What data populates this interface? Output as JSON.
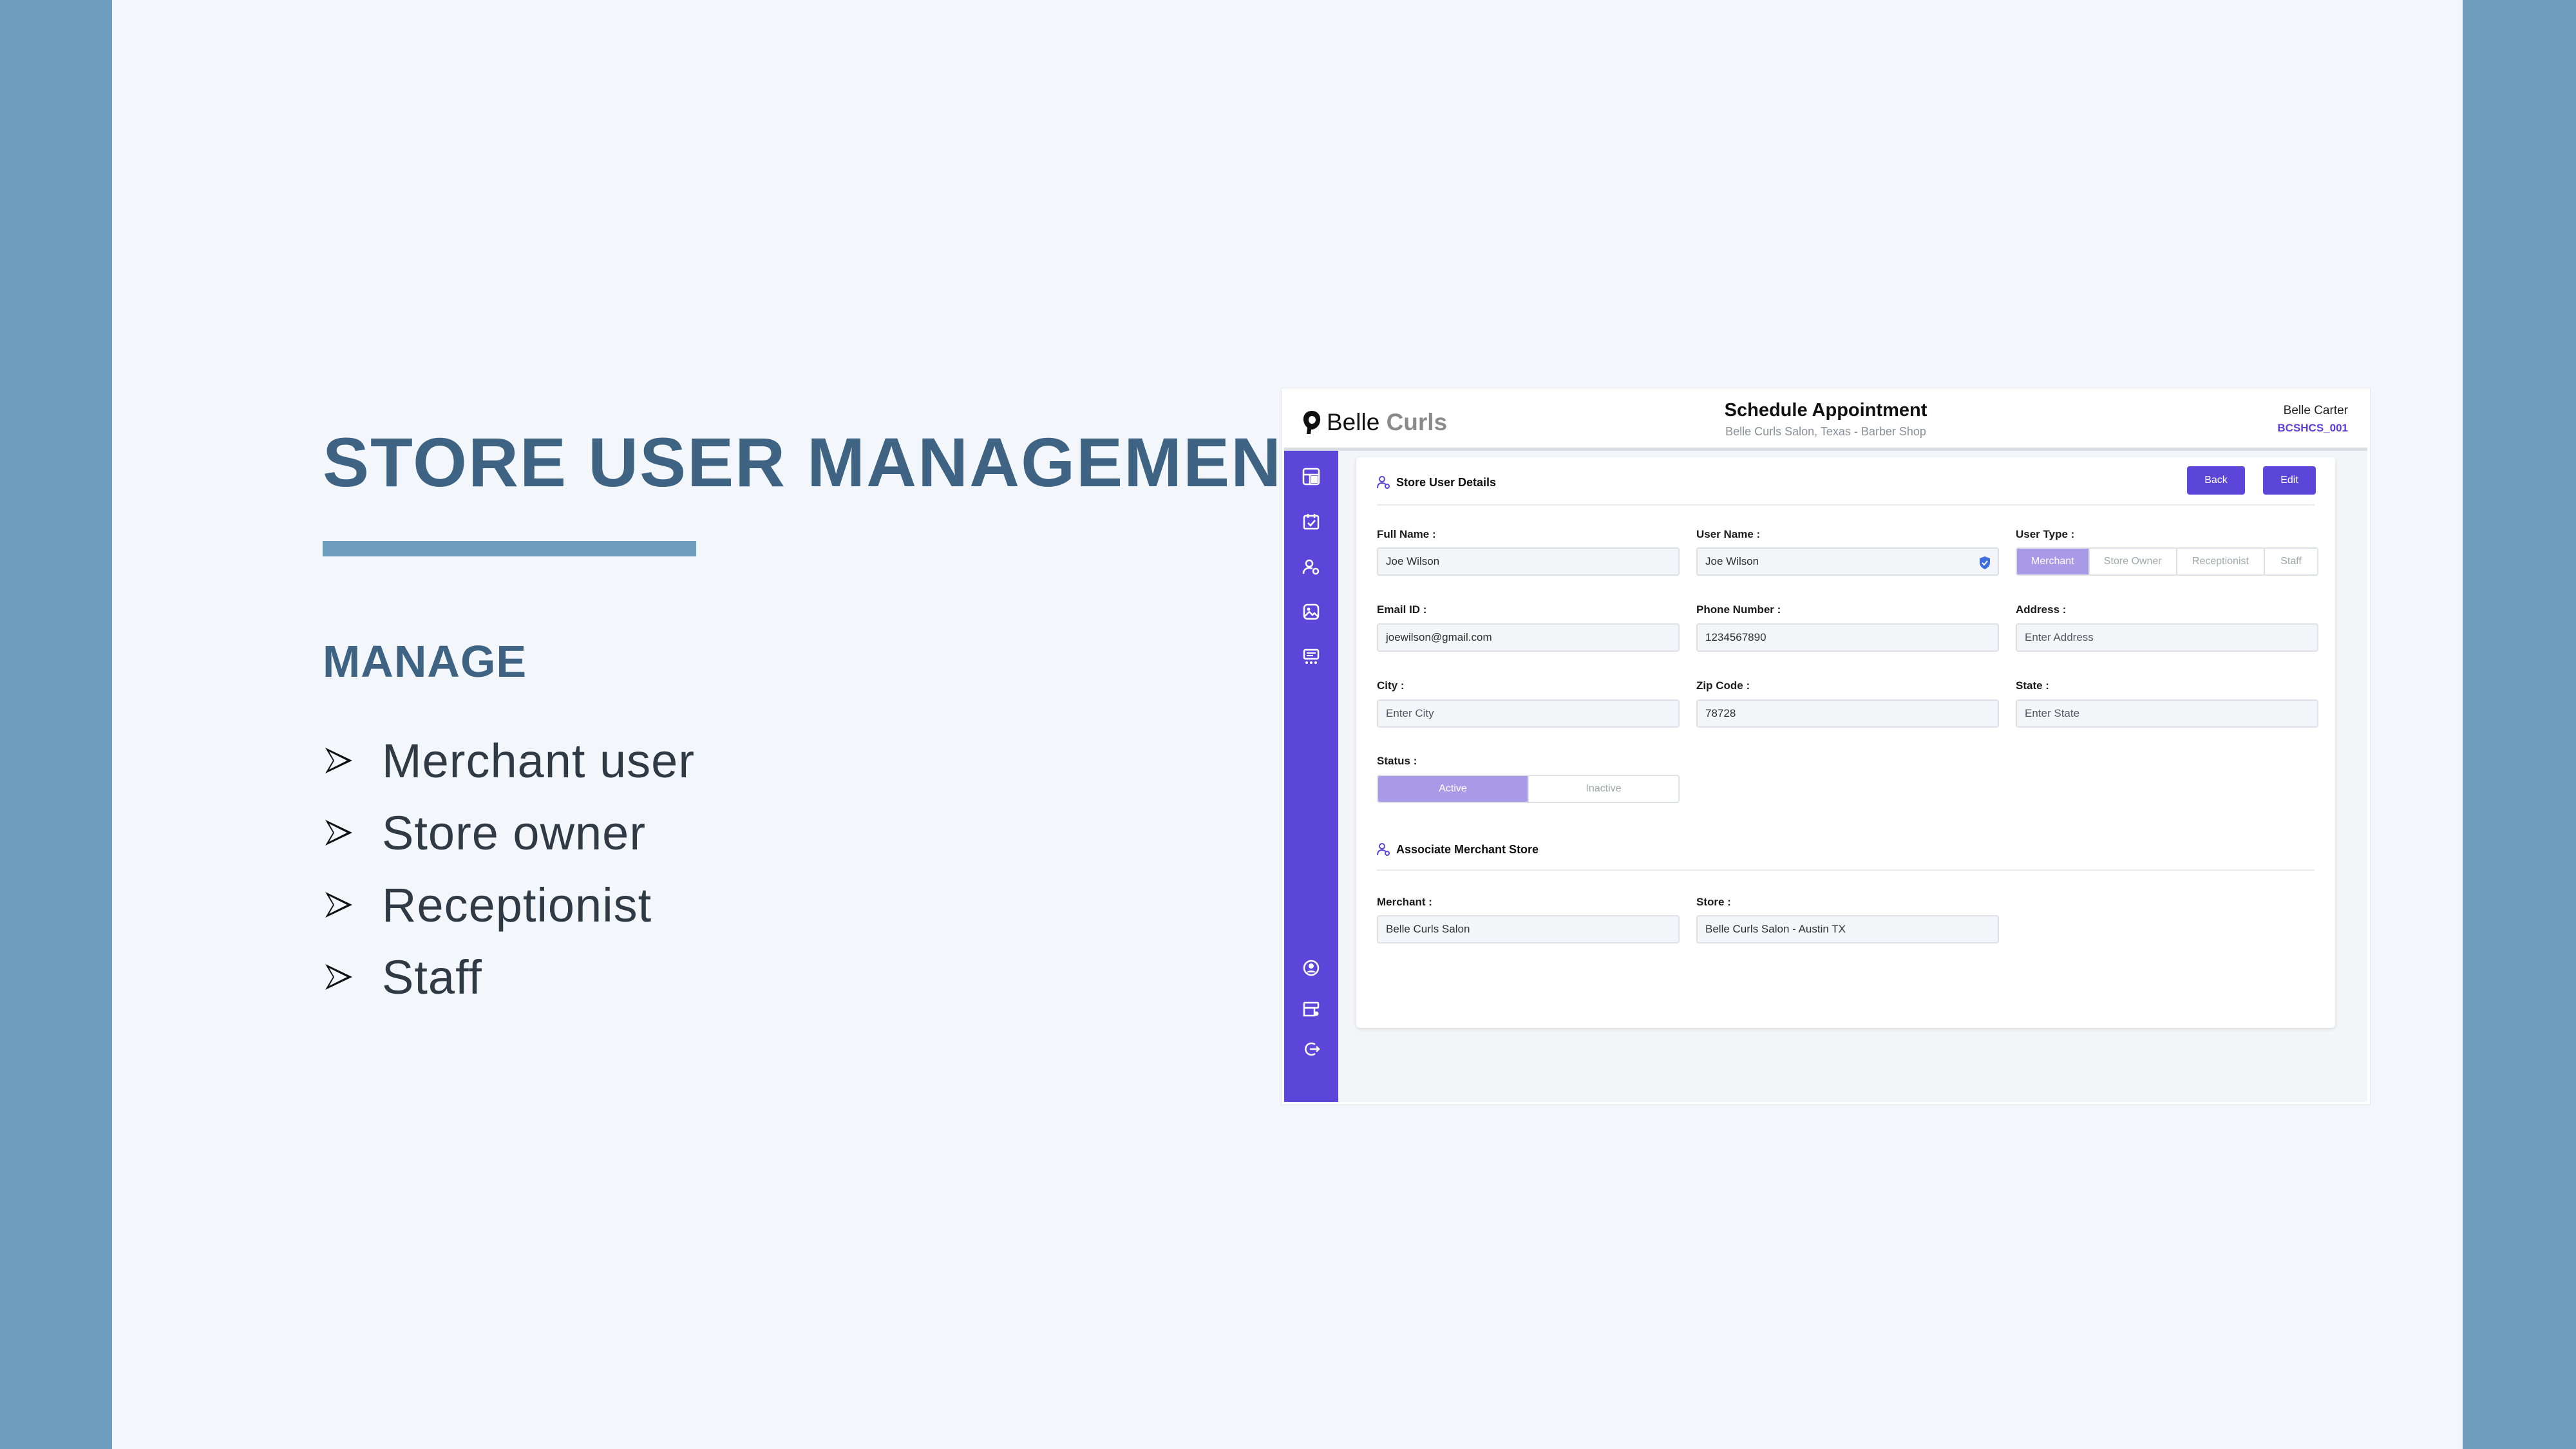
{
  "slide": {
    "title": "STORE USER MANAGEMENT",
    "subheading": "MANAGE",
    "bullets": [
      "Merchant user",
      "Store owner",
      "Receptionist",
      "Staff"
    ]
  },
  "app": {
    "brand": {
      "part1": "Belle",
      "part2": "Curls"
    },
    "page_title": "Schedule Appointment",
    "page_subtitle": "Belle Curls Salon, Texas - Barber Shop",
    "user": {
      "name": "Belle Carter",
      "code": "BCSHCS_001"
    },
    "sidebar_icons_top": [
      "dashboard-icon",
      "calendar-check-icon",
      "user-settings-icon",
      "gallery-icon",
      "services-icon"
    ],
    "sidebar_icons_bottom": [
      "profile-icon",
      "store-settings-icon",
      "logout-icon"
    ],
    "details": {
      "section_title": "Store User Details",
      "back_label": "Back",
      "edit_label": "Edit",
      "full_name": {
        "label": "Full Name :",
        "value": "Joe Wilson"
      },
      "user_name": {
        "label": "User Name :",
        "value": "Joe Wilson"
      },
      "user_type": {
        "label": "User Type :",
        "options": [
          "Merchant",
          "Store Owner",
          "Receptionist",
          "Staff"
        ],
        "selected": "Merchant"
      },
      "email": {
        "label": "Email ID :",
        "value": "joewilson@gmail.com"
      },
      "phone": {
        "label": "Phone Number :",
        "value": "1234567890"
      },
      "address": {
        "label": "Address :",
        "placeholder": "Enter Address"
      },
      "city": {
        "label": "City :",
        "placeholder": "Enter City"
      },
      "zip": {
        "label": "Zip Code :",
        "value": "78728"
      },
      "state": {
        "label": "State :",
        "placeholder": "Enter State"
      },
      "status": {
        "label": "Status :",
        "options": [
          "Active",
          "Inactive"
        ],
        "selected": "Active"
      }
    },
    "associate": {
      "section_title": "Associate Merchant Store",
      "merchant": {
        "label": "Merchant :",
        "value": "Belle Curls Salon"
      },
      "store": {
        "label": "Store :",
        "value": "Belle Curls Salon - Austin TX"
      }
    }
  },
  "colors": {
    "background": "#6f9dbd",
    "slide_bg": "#f3f7fb",
    "heading": "#3e6383",
    "accent_purple": "#5c45d9",
    "selected_segment": "#a99ae8"
  }
}
